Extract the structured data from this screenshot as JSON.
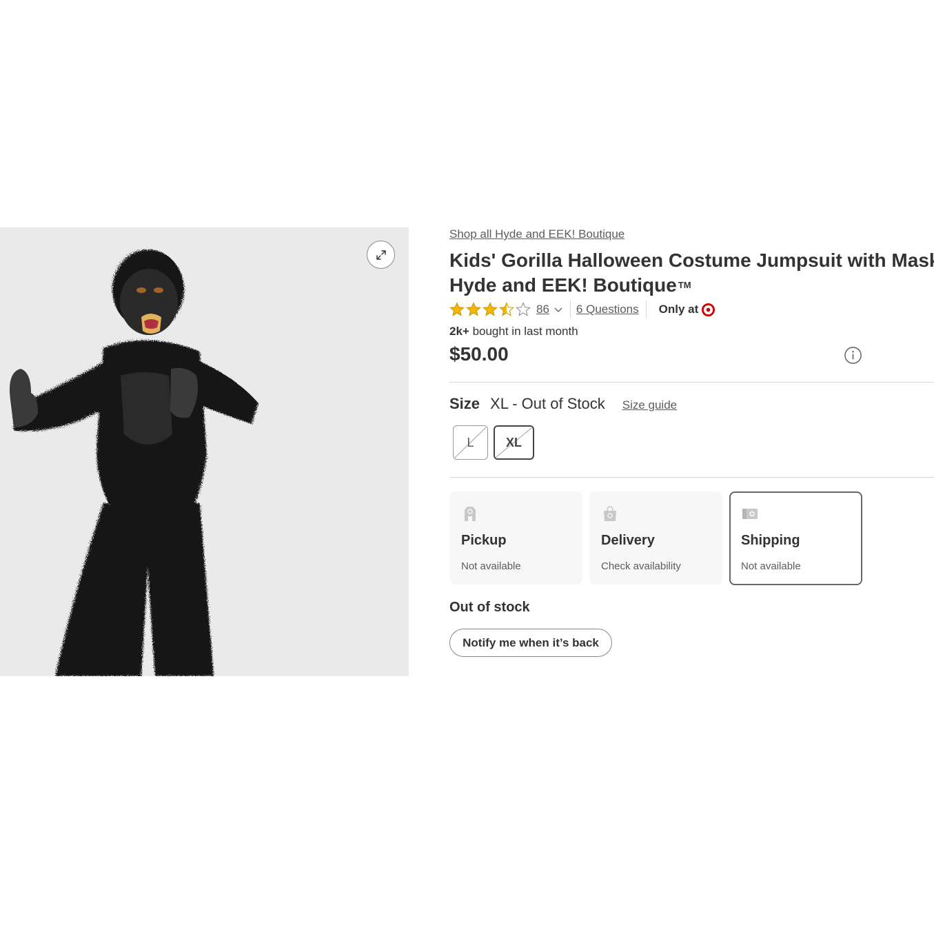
{
  "product": {
    "brand_link": "Shop all Hyde and EEK! Boutique",
    "title_line1": "Kids' Gorilla Halloween Costume Jumpsuit with Mask -",
    "title_line2": "Hyde and EEK! Boutique",
    "trademark": "TM",
    "rating": 3.5,
    "rating_max": 5,
    "review_count": "86",
    "questions_link": "6 Questions",
    "only_at": "Only at",
    "bought_strong": "2k+",
    "bought_rest": " bought in last month",
    "price": "$50.00"
  },
  "size": {
    "label": "Size",
    "selected_text": "XL - Out of Stock",
    "guide_link": "Size guide",
    "options": [
      {
        "label": "L",
        "selected": false,
        "available": false
      },
      {
        "label": "XL",
        "selected": true,
        "available": false
      }
    ]
  },
  "fulfillment": [
    {
      "title": "Pickup",
      "status": "Not available",
      "icon": "store-icon",
      "selected": false
    },
    {
      "title": "Delivery",
      "status": "Check availability",
      "icon": "shopping-bag-icon",
      "selected": false
    },
    {
      "title": "Shipping",
      "status": "Not available",
      "icon": "shipping-box-icon",
      "selected": true
    }
  ],
  "stock": {
    "status": "Out of stock",
    "notify_button": "Notify me when it’s back"
  },
  "colors": {
    "brand_red": "#cc0000",
    "star_gold": "#f2b705",
    "text_dark": "#333333",
    "text_muted": "#5c5c5c"
  }
}
